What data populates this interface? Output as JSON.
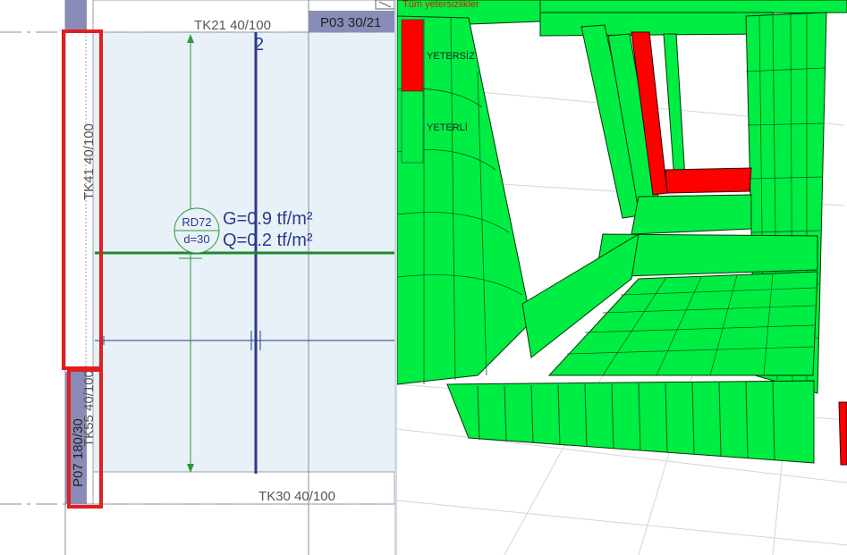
{
  "plan": {
    "beam_top": "TK21 40/100",
    "beam_bottom": "TK30 40/100",
    "beam_left": "TK41 40/100",
    "beam_left_lower": "TK55 40/100",
    "column_top_right": "P03 30/21",
    "column_bottom_left": "P07 180/30",
    "axis_label": "2",
    "slab_id": "RD72",
    "slab_thickness": "d=30",
    "load_g": "G=0.9 tf/m²",
    "load_q": "Q=0.2 tf/m²",
    "colors": {
      "slab_fill": "#e8f0f8",
      "axis_blue": "#2b3a8c",
      "load_green": "#1a8a2a",
      "dim_green": "#2a9a3a",
      "highlight_red": "#e02020",
      "column_fill": "#8a8cb8"
    }
  },
  "view3d": {
    "title": "Tüm yetersizlikler",
    "legend": [
      {
        "label": "YETERSİZ",
        "color": "#ff0000"
      },
      {
        "label": "YETERLİ",
        "color": "#00ee44"
      }
    ]
  }
}
